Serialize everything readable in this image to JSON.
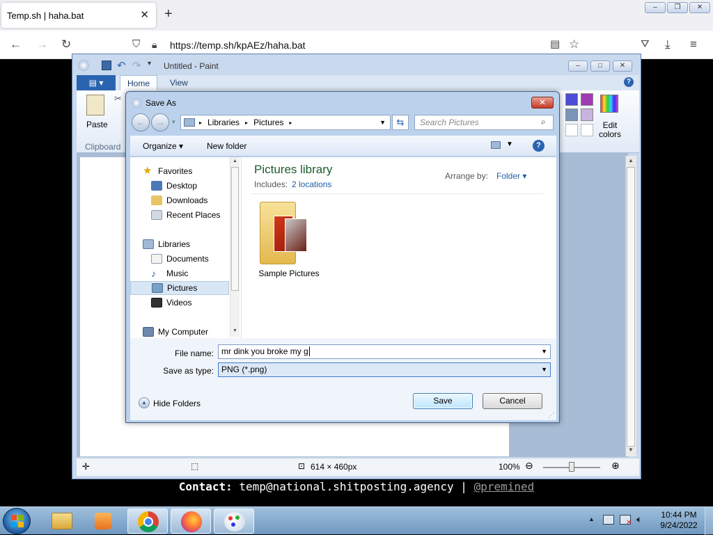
{
  "browser": {
    "tab_title": "Temp.sh | haha.bat",
    "url": "https://temp.sh/kpAEz/haha.bat"
  },
  "paint": {
    "title": "Untitled - Paint",
    "tabs": [
      "Home",
      "View"
    ],
    "paste_label": "Paste",
    "clipboard_label": "Clipboard",
    "edit_colors_label": "Edit colors",
    "status_size": "614 × 460px",
    "zoom": "100%"
  },
  "dialog": {
    "title": "Save As",
    "breadcrumb": [
      "Libraries",
      "Pictures"
    ],
    "search_placeholder": "Search Pictures",
    "organize_label": "Organize",
    "new_folder_label": "New folder",
    "nav": {
      "favorites": "Favorites",
      "favorites_items": [
        "Desktop",
        "Downloads",
        "Recent Places"
      ],
      "libraries": "Libraries",
      "libraries_items": [
        "Documents",
        "Music",
        "Pictures",
        "Videos"
      ],
      "computer": "My Computer"
    },
    "library_title": "Pictures library",
    "includes_label": "Includes:",
    "includes_link": "2 locations",
    "arrange_label": "Arrange by:",
    "arrange_value": "Folder",
    "folder_item": "Sample Pictures",
    "file_name_label": "File name:",
    "file_name_value": "mr dink you broke my g",
    "save_type_label": "Save as type:",
    "save_type_value": "PNG (*.png)",
    "hide_folders_label": "Hide Folders",
    "save_label": "Save",
    "cancel_label": "Cancel"
  },
  "overlay": {
    "contact_label": "Contact:",
    "contact_email": "temp@national.shitposting.agency",
    "separator": "|",
    "handle": "@premined"
  },
  "taskbar": {
    "time": "10:44 PM",
    "date": "9/24/2022"
  }
}
